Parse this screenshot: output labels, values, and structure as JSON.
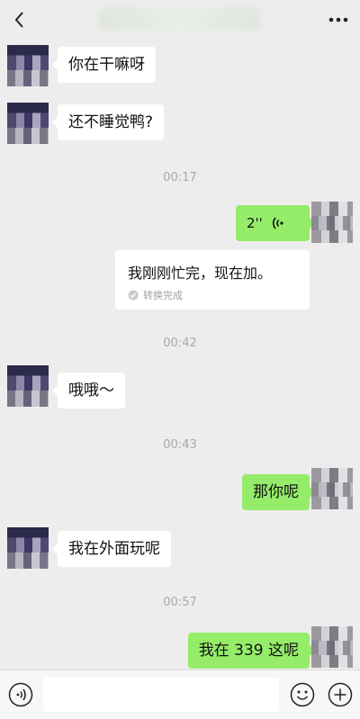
{
  "messages": {
    "m1": "你在干嘛呀",
    "m2": "还不睡觉鸭?",
    "t1": "00:17",
    "voice_duration": "2''",
    "voice_transcript": "我刚刚忙完，现在加。",
    "voice_status": "转换完成",
    "t2": "00:42",
    "m3": "哦哦～",
    "t3": "00:43",
    "m4": "那你呢",
    "m5": "我在外面玩呢",
    "t4": "00:57",
    "m6": "我在 339 这呢"
  },
  "colors": {
    "background": "#ededed",
    "sent_bubble": "#95ec69",
    "received_bubble": "#ffffff",
    "timestamp": "#a8a8a8"
  },
  "icons": {
    "back": "chevron-left-icon",
    "more": "more-dots-icon",
    "voice": "voice-wave-icon",
    "check": "check-circle-icon",
    "voice_input": "voice-input-icon",
    "emoji": "emoji-icon",
    "add": "plus-circle-icon"
  }
}
